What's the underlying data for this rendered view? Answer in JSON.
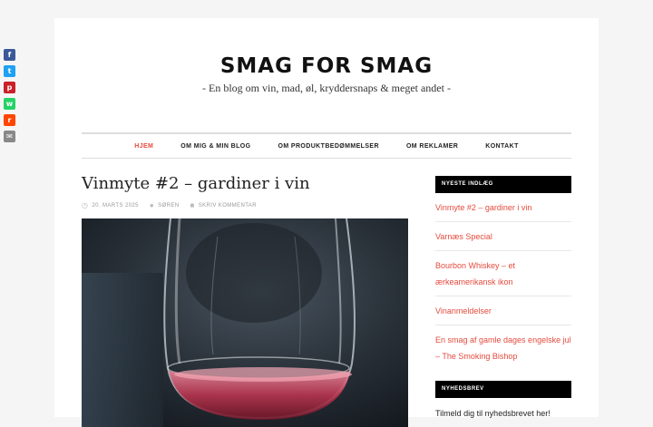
{
  "share": [
    {
      "name": "Facebook",
      "icon": "facebook-icon",
      "color": "#3b5998",
      "glyph": "f"
    },
    {
      "name": "Twitter",
      "icon": "twitter-icon",
      "color": "#1da1f2",
      "glyph": "t"
    },
    {
      "name": "Pinterest",
      "icon": "pinterest-icon",
      "color": "#cb2027",
      "glyph": "p"
    },
    {
      "name": "WhatsApp",
      "icon": "whatsapp-icon",
      "color": "#25d366",
      "glyph": "w"
    },
    {
      "name": "Reddit",
      "icon": "reddit-icon",
      "color": "#ff4500",
      "glyph": "r"
    },
    {
      "name": "Email",
      "icon": "email-icon",
      "color": "#888888",
      "glyph": "✉"
    }
  ],
  "site": {
    "title": "SMAG FOR SMAG",
    "tagline": "- En blog om vin, mad, øl, kryddersnaps & meget andet -"
  },
  "nav": {
    "items": [
      "HJEM",
      "OM MIG & MIN BLOG",
      "OM PRODUKTBEDØMMELSER",
      "OM REKLAMER",
      "KONTAKT"
    ],
    "active_index": 0,
    "active_color": "#e44b3d"
  },
  "post": {
    "title": "Vinmyte #2 – gardiner i vin",
    "date": "20. MARTS 2025",
    "author": "SØREN",
    "comment": "SKRIV KOMMENTAR"
  },
  "sidebar": {
    "recent_title": "NYESTE INDLÆG",
    "recent": [
      "Vinmyte #2 – gardiner i vin",
      "Varnæs Special",
      "Bourbon Whiskey – et ærkeamerikansk ikon",
      "Vinanmeldelser",
      "En smag af gamle dages engelske jul – The Smoking Bishop"
    ],
    "newsletter_title": "NYHEDSBREV",
    "newsletter_text": "Tilmeld dig til nyhedsbrevet her!"
  },
  "colors": {
    "accent": "#e44b3d",
    "widget_bg": "#000000"
  }
}
